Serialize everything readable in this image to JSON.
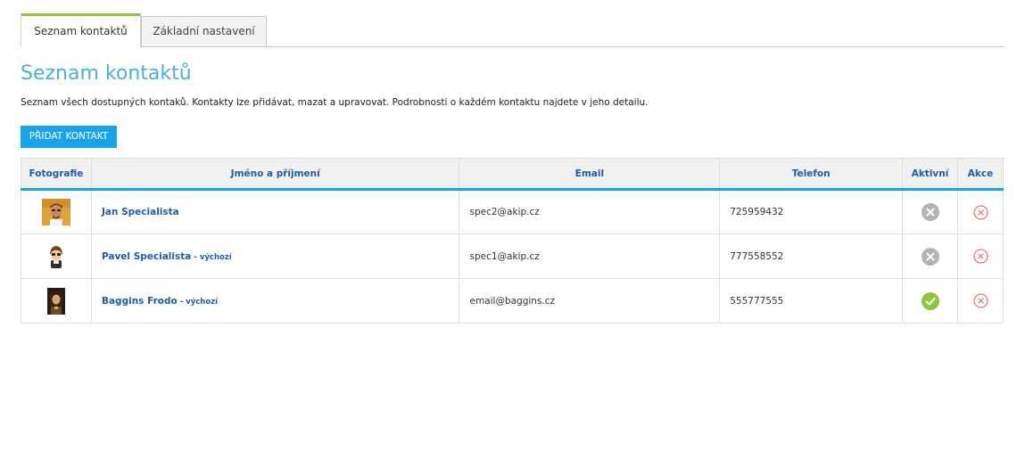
{
  "tabs": [
    {
      "label": "Seznam kontaktů",
      "active": true
    },
    {
      "label": "Základní nastavení",
      "active": false
    }
  ],
  "page": {
    "title": "Seznam kontaktů",
    "description": "Seznam všech dostupných kontaků. Kontakty lze přidávat, mazat a upravovat. Podrobnosti o každém kontaktu najdete v jeho detailu.",
    "add_button": "PŘIDAT KONTAKT"
  },
  "table": {
    "headers": [
      "Fotografie",
      "Jméno a příjmení",
      "Email",
      "Telefon",
      "Aktivní",
      "Akce"
    ],
    "rows": [
      {
        "name": "Jan Specialista",
        "tag": "",
        "email": "spec2@akip.cz",
        "phone": "725959432",
        "active": false,
        "photo_icon": "person-photo-icon"
      },
      {
        "name": "Pavel Specialista",
        "tag": "- výchozí",
        "email": "spec1@akip.cz",
        "phone": "777558552",
        "active": false,
        "photo_icon": "cartoon-avatar-icon"
      },
      {
        "name": "Baggins Frodo",
        "tag": "- výchozí",
        "email": "email@baggins.cz",
        "phone": "555777555",
        "active": true,
        "photo_icon": "person-photo-icon"
      }
    ]
  },
  "colors": {
    "accent": "#1aa3e8",
    "title": "#4aaee0",
    "link": "#1d5ea8",
    "active_tab_top": "#8cc63f",
    "active_ok": "#8cc63f",
    "inactive_gray": "#b3b3b3",
    "delete_red": "#e0594e"
  }
}
